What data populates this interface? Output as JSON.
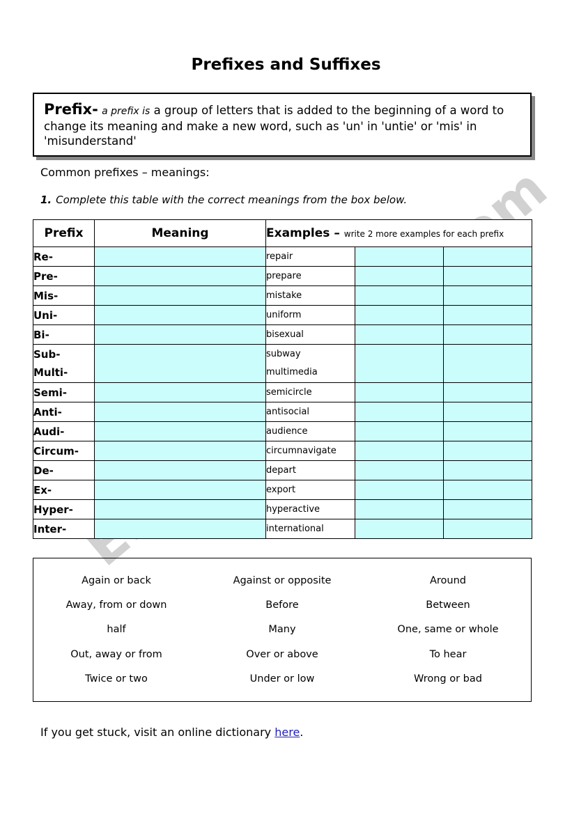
{
  "title": "Prefixes and Suffixes",
  "watermark": "ESLprintables.com",
  "definition": {
    "term": "Prefix-",
    "italic_part": "a prefix is",
    "rest": " a group of letters that is added to the beginning of a word to change its meaning and make a new word, such as 'un' in 'untie' or 'mis' in 'misunderstand'"
  },
  "lead_in": "Common prefixes – meanings:",
  "instruction": {
    "number": "1.",
    "text": "Complete this table with the correct meanings from the box below."
  },
  "table": {
    "headers": {
      "prefix": "Prefix",
      "meaning": "Meaning",
      "examples_big": "Examples –",
      "examples_small": "write 2 more examples for each prefix"
    },
    "rows": [
      {
        "prefix": "Re-",
        "meaning": "",
        "example": "repair",
        "example2": "",
        "example3": ""
      },
      {
        "prefix": "Pre-",
        "meaning": "",
        "example": "prepare",
        "example2": "",
        "example3": ""
      },
      {
        "prefix": "Mis-",
        "meaning": "",
        "example": "mistake",
        "example2": "",
        "example3": ""
      },
      {
        "prefix": "Uni-",
        "meaning": "",
        "example": "uniform",
        "example2": "",
        "example3": ""
      },
      {
        "prefix": "Bi-",
        "meaning": "",
        "example": "bisexual",
        "example2": "",
        "example3": ""
      },
      {
        "prefix": "Sub-",
        "prefix_b": "Multi-",
        "meaning": "",
        "example": "subway",
        "example_b": "multimedia",
        "example2": "",
        "example3": "",
        "tall": true
      },
      {
        "prefix": "Semi-",
        "meaning": "",
        "example": "semicircle",
        "example2": "",
        "example3": ""
      },
      {
        "prefix": "Anti-",
        "meaning": "",
        "example": "antisocial",
        "example2": "",
        "example3": ""
      },
      {
        "prefix": "Audi-",
        "meaning": "",
        "example": "audience",
        "example2": "",
        "example3": ""
      },
      {
        "prefix": "Circum-",
        "meaning": "",
        "example": "circumnavigate",
        "example2": "",
        "example3": ""
      },
      {
        "prefix": "De-",
        "meaning": "",
        "example": "depart",
        "example2": "",
        "example3": ""
      },
      {
        "prefix": "Ex-",
        "meaning": "",
        "example": "export",
        "example2": "",
        "example3": ""
      },
      {
        "prefix": "Hyper-",
        "meaning": "",
        "example": "hyperactive",
        "example2": "",
        "example3": ""
      },
      {
        "prefix": "Inter-",
        "meaning": "",
        "example": "international",
        "example2": "",
        "example3": ""
      }
    ]
  },
  "word_bank": {
    "rows": [
      [
        "Again or back",
        "Against or opposite",
        "Around"
      ],
      [
        "Away, from or down",
        "Before",
        "Between"
      ],
      [
        "half",
        "Many",
        "One, same or whole"
      ],
      [
        "Out, away or from",
        "Over or above",
        "To hear"
      ],
      [
        "Twice or two",
        "Under or low",
        "Wrong or bad"
      ]
    ]
  },
  "footer": {
    "before": "If you get stuck, visit an online dictionary ",
    "link": "here",
    "after": "."
  },
  "colors": {
    "fill": "#CCFDFD",
    "link": "#2222BB",
    "watermark": "#C9C9C9",
    "border": "#000000"
  }
}
